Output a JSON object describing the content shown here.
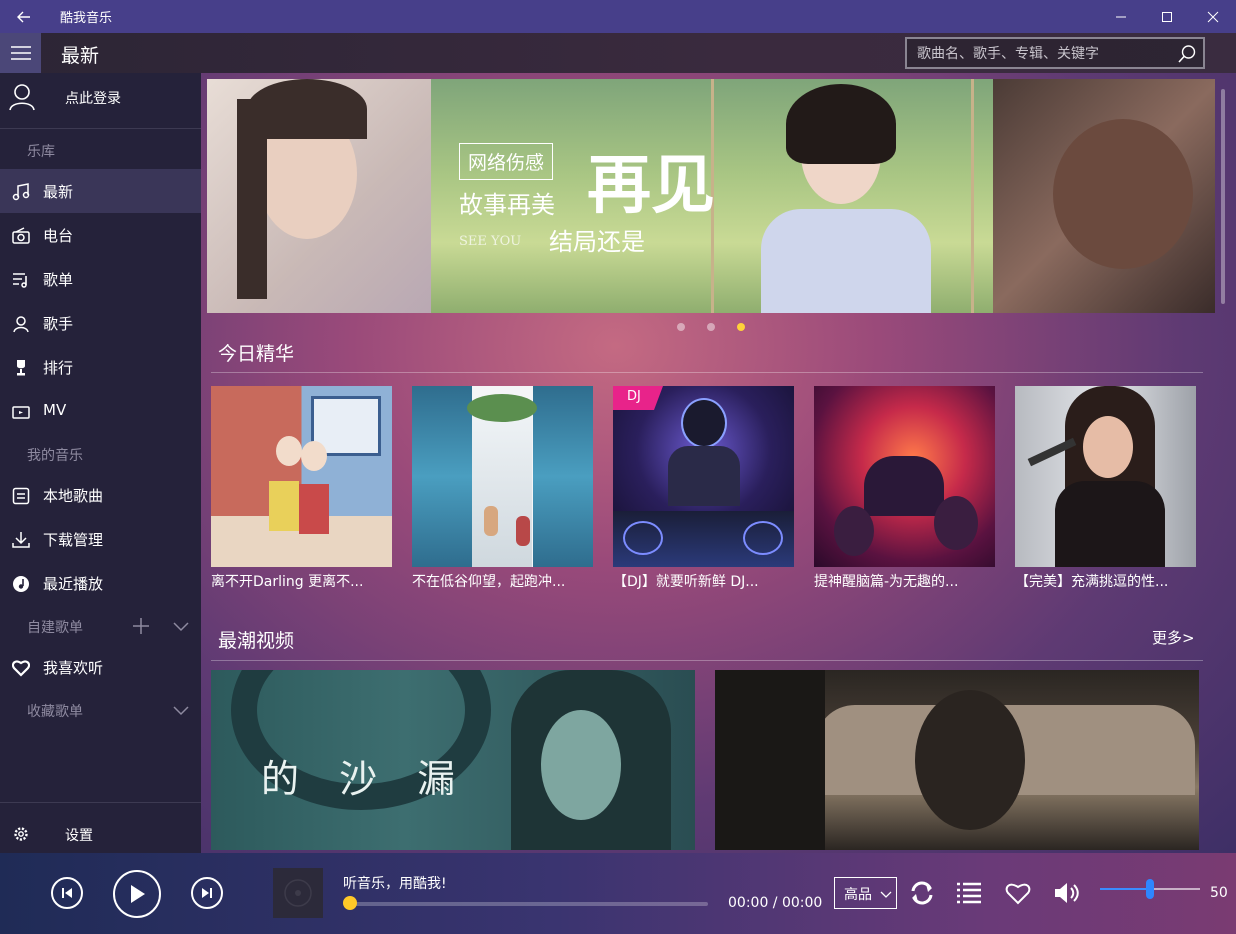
{
  "window": {
    "title": "酷我音乐"
  },
  "header": {
    "page_title": "最新",
    "search_placeholder": "歌曲名、歌手、专辑、关键字"
  },
  "sidebar": {
    "login_label": "点此登录",
    "library_header": "乐库",
    "library_items": [
      {
        "label": "最新",
        "icon": "music-note-icon"
      },
      {
        "label": "电台",
        "icon": "radio-icon"
      },
      {
        "label": "歌单",
        "icon": "playlist-icon"
      },
      {
        "label": "歌手",
        "icon": "singer-icon"
      },
      {
        "label": "排行",
        "icon": "trophy-icon"
      },
      {
        "label": "MV",
        "icon": "tv-icon"
      }
    ],
    "my_music_header": "我的音乐",
    "my_items": [
      {
        "label": "本地歌曲",
        "icon": "local-music-icon"
      },
      {
        "label": "下载管理",
        "icon": "download-icon"
      },
      {
        "label": "最近播放",
        "icon": "recent-play-icon"
      }
    ],
    "custom_playlists_header": "自建歌单",
    "favorites_label": "我喜欢听",
    "collected_playlists_header": "收藏歌单",
    "settings_label": "设置"
  },
  "banner": {
    "tag": "网络伤感",
    "line1": "故事再美",
    "big": "再见",
    "en": "SEE YOU",
    "line2": "结局还是",
    "active_slide": 3,
    "slide_count": 3
  },
  "today": {
    "title": "今日精华",
    "cards": [
      {
        "caption": "离不开Darling 更离不...",
        "badge": ""
      },
      {
        "caption": "不在低谷仰望，起跑冲...",
        "badge": ""
      },
      {
        "caption": "【DJ】就要听新鲜 DJ...",
        "badge": "DJ"
      },
      {
        "caption": "提神醒脑篇-为无趣的...",
        "badge": ""
      },
      {
        "caption": "【完美】充满挑逗的性...",
        "badge": ""
      }
    ]
  },
  "videos": {
    "title": "最潮视频",
    "more": "更多>",
    "thumb1_text": "的 沙 漏"
  },
  "player": {
    "track_title": "听音乐，用酷我!",
    "time": "00:00 / 00:00",
    "progress": 0,
    "quality": "高品",
    "volume": "50"
  },
  "colors": {
    "accent_yellow": "#ffd23a",
    "titlebar": "#473f8a",
    "sidebar": "#25223a",
    "volume_blue": "#2e86ff"
  }
}
